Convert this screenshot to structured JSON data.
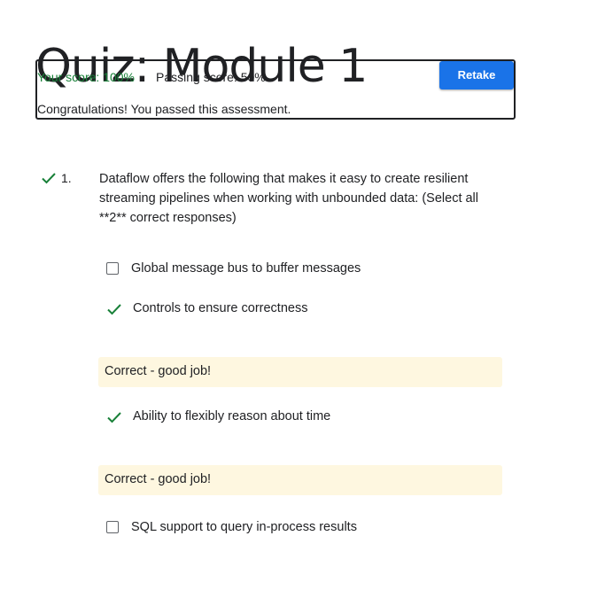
{
  "page_title": "Quiz: Module 1",
  "score": {
    "your_score": "Your score: 100%",
    "passing_score": "Passing score: 50%",
    "message": "Congratulations! You passed this assessment.",
    "retake_label": "Retake"
  },
  "question": {
    "number": "1.",
    "status_icon": "checkmark-icon",
    "text": "Dataflow offers the following that makes it easy to create resilient streaming pipelines when working with unbounded data: (Select all **2** correct responses)",
    "options": [
      {
        "label": "Global message bus to buffer messages",
        "state": "unchecked"
      },
      {
        "label": "Controls to ensure correctness",
        "state": "correct",
        "feedback": "Correct - good job!"
      },
      {
        "label": "Ability to flexibly reason about time",
        "state": "correct",
        "feedback": "Correct - good job!"
      },
      {
        "label": "SQL support to query in-process results",
        "state": "unchecked"
      }
    ]
  },
  "colors": {
    "accent": "#1a73e8",
    "success": "#188038",
    "feedback_bg": "#fef7e0",
    "text": "#202124"
  }
}
